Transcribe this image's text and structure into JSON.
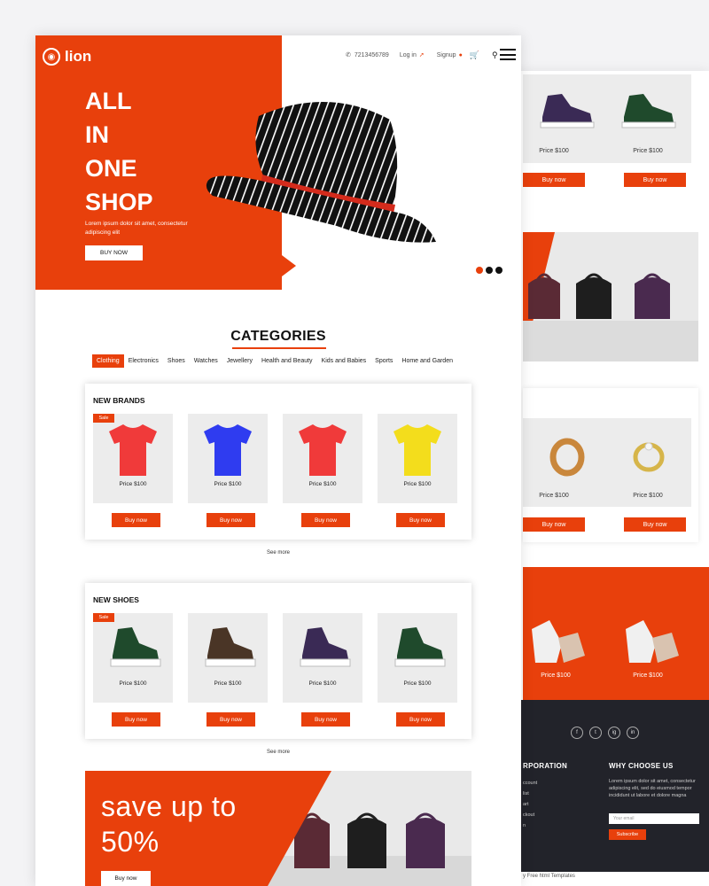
{
  "brand": {
    "name": "lion",
    "accent": "#e8400c",
    "dark": "#22232a"
  },
  "nav": {
    "phone": "7213456789",
    "login": "Log in",
    "signup": "Signup",
    "icons": [
      "phone-icon",
      "login-icon",
      "user-icon",
      "cart-icon",
      "search-icon",
      "menu-icon"
    ]
  },
  "hero": {
    "lines": [
      "ALL",
      "IN",
      "ONE",
      "SHOP"
    ],
    "description": "Lorem ipsum dolor sit amet, consectetur adipiscing elit",
    "button": "BUY NOW"
  },
  "categories": {
    "title": "CATEGORIES",
    "tabs": [
      "Clothing",
      "Electronics",
      "Shoes",
      "Watches",
      "Jewellery",
      "Health and Beauty",
      "Kids and Babies",
      "Sports",
      "Home and Garden"
    ],
    "active": "Clothing"
  },
  "new_brands": {
    "title": "NEW BRANDS",
    "badge": "Sale",
    "products": [
      {
        "price": "Price $100",
        "button": "Buy now",
        "color": "#f03a3a"
      },
      {
        "price": "Price $100",
        "button": "Buy now",
        "color": "#2f3cf0"
      },
      {
        "price": "Price $100",
        "button": "Buy now",
        "color": "#f03a3a"
      },
      {
        "price": "Price $100",
        "button": "Buy now",
        "color": "#f3dd1c"
      }
    ],
    "see_more": "See more"
  },
  "new_shoes": {
    "title": "NEW SHOES",
    "badge": "Sale",
    "products": [
      {
        "price": "Price $100",
        "button": "Buy now",
        "color": "#1f4a2c"
      },
      {
        "price": "Price $100",
        "button": "Buy now",
        "color": "#4a3526"
      },
      {
        "price": "Price $100",
        "button": "Buy now",
        "color": "#3a2a55"
      },
      {
        "price": "Price $100",
        "button": "Buy now",
        "color": "#1f4a2c"
      }
    ],
    "see_more": "See more"
  },
  "promo": {
    "line1": "save up to",
    "line2": "50%",
    "button": "Buy now"
  },
  "back_page": {
    "shoe_prices": [
      "Price $100",
      "Price $100"
    ],
    "shoe_buttons": [
      "Buy now",
      "Buy now"
    ],
    "ring_prices": [
      "Price $100",
      "Price $100"
    ],
    "ring_buttons": [
      "Buy now",
      "Buy now"
    ],
    "boot_prices": [
      "Price $100",
      "Price $100"
    ],
    "footer": {
      "social": [
        "f",
        "t",
        "ig",
        "in"
      ],
      "col1_title": "RPORATION",
      "col1_links": [
        "ccount",
        "list",
        "art",
        "ckout",
        "n"
      ],
      "col2_title": "WHY CHOOSE US",
      "col2_text": "Lorem ipsum dolor sit amet, consectetur adipiscing elit, sed do eiusmod tempor incididunt ut labore et dolore magna",
      "email_placeholder": "Your email",
      "subscribe": "Subscribe",
      "copyright": "y Free html Templates"
    }
  }
}
